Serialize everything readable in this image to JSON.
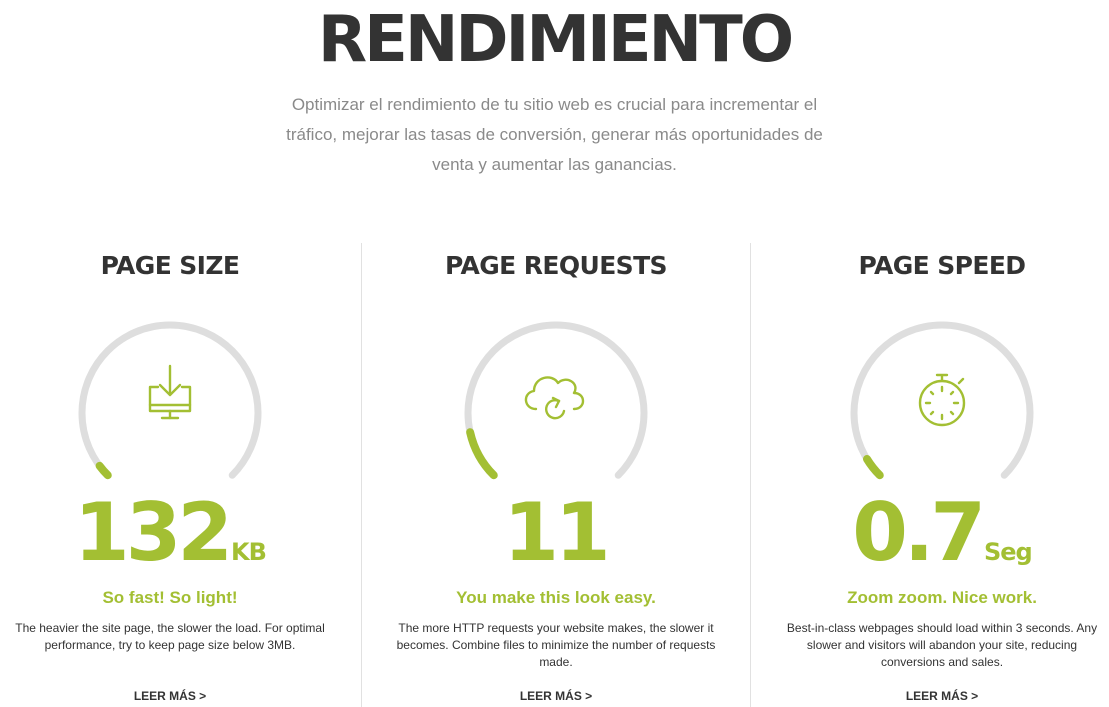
{
  "hero": {
    "title": "RENDIMIENTO",
    "subtitle": "Optimizar el rendimiento de tu sitio web es crucial para incrementar el tráfico, mejorar las tasas de conversión, generar más oportunidades de venta y aumentar las ganancias."
  },
  "colors": {
    "accent": "#a3bf33",
    "track": "#dedede",
    "heading": "#333333",
    "muted": "#8a8a8a"
  },
  "metrics": [
    {
      "title": "PAGE SIZE",
      "icon": "download-monitor-icon",
      "value": "132",
      "unit": "KB",
      "gauge_fill_fraction": 0.03,
      "tagline": "So fast! So light!",
      "description": "The heavier the site page, the slower the load. For optimal performance, try to keep page size below 3MB.",
      "link": "LEER MÁS >"
    },
    {
      "title": "PAGE REQUESTS",
      "icon": "cloud-sync-icon",
      "value": "11",
      "unit": "",
      "gauge_fill_fraction": 0.12,
      "tagline": "You make this look easy.",
      "description": "The more HTTP requests your website makes, the slower it becomes. Combine files to minimize the number of requests made.",
      "link": "LEER MÁS >"
    },
    {
      "title": "PAGE SPEED",
      "icon": "stopwatch-icon",
      "value": "0.7",
      "unit": "Seg",
      "gauge_fill_fraction": 0.05,
      "tagline": "Zoom zoom. Nice work.",
      "description": "Best-in-class webpages should load within 3 seconds. Any slower and visitors will abandon your site, reducing conversions and sales.",
      "link": "LEER MÁS >"
    }
  ]
}
